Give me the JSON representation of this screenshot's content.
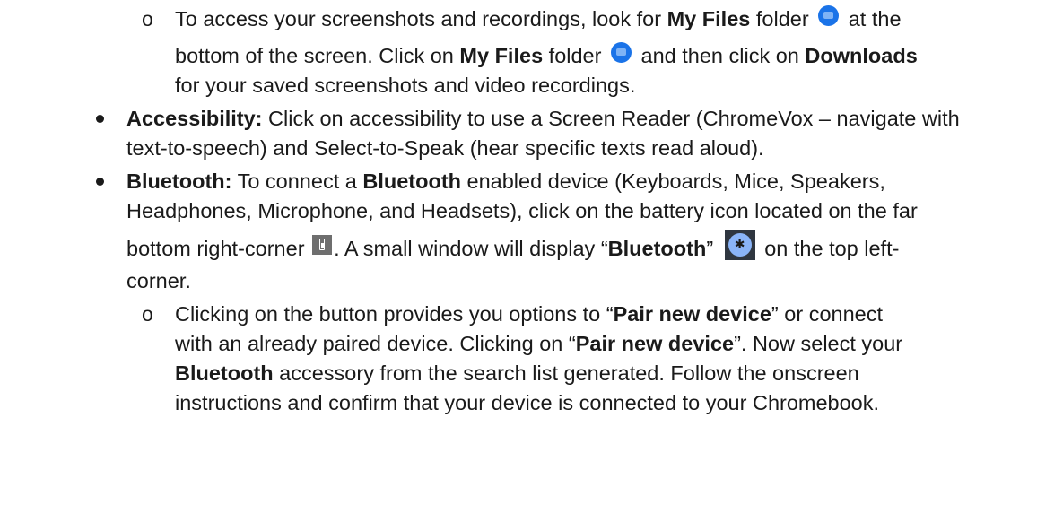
{
  "bullets": {
    "circle": "o",
    "disc": "•"
  },
  "screenshots_item": {
    "l1_a": "To access your screenshots and recordings, look for ",
    "l1_b": "My Files",
    "l1_c": " folder ",
    "l1_d": " at the",
    "l2_a": "bottom of the screen. Click on ",
    "l2_b": "My Files",
    "l2_c": " folder ",
    "l2_d": " and then click on ",
    "l2_e": "Downloads",
    "l3": "for your saved screenshots and video recordings."
  },
  "accessibility_item": {
    "label": "Accessibility:",
    "l1_rest": " Click on accessibility to use a Screen Reader (ChromeVox – navigate with",
    "l2": "text-to-speech) and Select-to-Speak (hear specific texts read aloud)."
  },
  "bluetooth_item": {
    "label": "Bluetooth:",
    "l1_a": " To connect a ",
    "l1_b": "Bluetooth",
    "l1_c": " enabled device (Keyboards, Mice, Speakers,",
    "l2": "Headphones, Microphone, and Headsets), click on the battery icon located on the far",
    "l3_a": "bottom right-corner ",
    "l3_b": ".  A small window will display “",
    "l3_c": "Bluetooth",
    "l3_d": "” ",
    "l3_e": " on the top left-",
    "l4": "corner."
  },
  "pair_item": {
    "l1_a": "Clicking on the button provides you options to “",
    "l1_b": "Pair new device",
    "l1_c": "” or connect",
    "l2_a": "with an already paired device. Clicking on “",
    "l2_b": "Pair new device",
    "l2_c": "”. Now select your",
    "l3_a": "Bluetooth",
    "l3_b": " accessory from the search list generated. Follow the onscreen",
    "l4": "instructions and confirm that your device is connected to your Chromebook."
  },
  "icons": {
    "folder": "my-files-folder-icon",
    "battery": "battery-icon",
    "bluetooth": "bluetooth-icon",
    "bluetooth_glyph": "✱"
  }
}
